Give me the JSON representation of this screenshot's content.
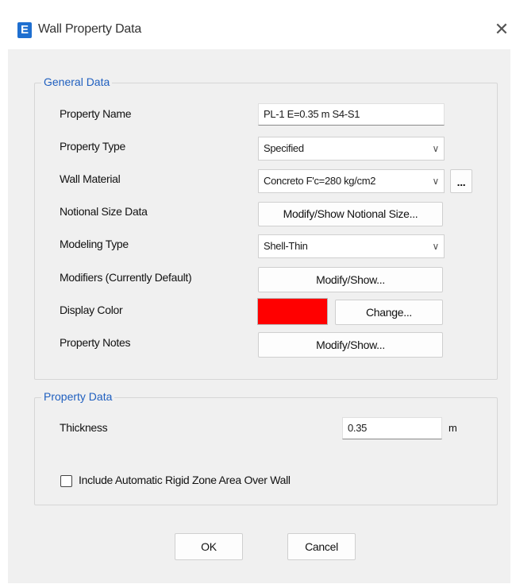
{
  "window": {
    "app_icon_letter": "E",
    "title": "Wall Property Data",
    "close_glyph": "✕"
  },
  "general_data": {
    "legend": "General Data",
    "property_name": {
      "label": "Property Name",
      "value": "PL-1 E=0.35 m S4-S1"
    },
    "property_type": {
      "label": "Property Type",
      "value": "Specified"
    },
    "wall_material": {
      "label": "Wall Material",
      "value": "Concreto F'c=280 kg/cm2",
      "browse_label": "..."
    },
    "notional_size": {
      "label": "Notional Size Data",
      "button_label": "Modify/Show Notional Size..."
    },
    "modeling_type": {
      "label": "Modeling Type",
      "value": "Shell-Thin"
    },
    "modifiers": {
      "label": "Modifiers (Currently Default)",
      "button_label": "Modify/Show..."
    },
    "display_color": {
      "label": "Display Color",
      "color": "#ff0000",
      "button_label": "Change..."
    },
    "property_notes": {
      "label": "Property Notes",
      "button_label": "Modify/Show..."
    }
  },
  "property_data": {
    "legend": "Property Data",
    "thickness": {
      "label": "Thickness",
      "value": "0.35",
      "unit": "m"
    },
    "rigid_zone": {
      "label": "Include Automatic Rigid Zone Area Over Wall",
      "checked": false
    }
  },
  "footer": {
    "ok_label": "OK",
    "cancel_label": "Cancel"
  },
  "icons": {
    "dropdown": "chevron-down-icon",
    "close": "close-icon",
    "app": "etabs-app-icon"
  },
  "colors": {
    "accent": "#1f5fbf",
    "app_icon": "#1e6fd0",
    "swatch": "#ff0000"
  }
}
